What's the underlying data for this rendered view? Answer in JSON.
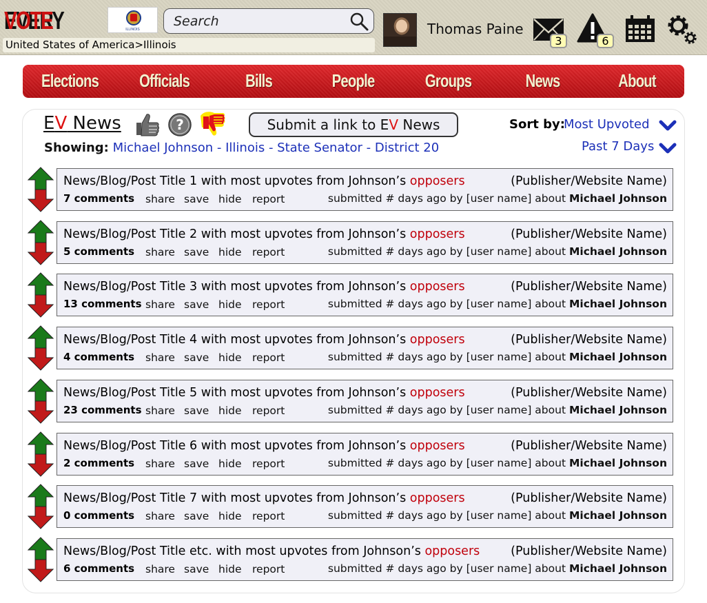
{
  "header": {
    "logo_every": "EVERY",
    "logo_vote": "VOTE",
    "flag_caption": "ILLINOIS",
    "search_placeholder": "Search",
    "breadcrumb": "United States of America>Illinois",
    "username": "Thomas Paine",
    "mail_count": "3",
    "alert_count": "6"
  },
  "nav": [
    "Elections",
    "Officials",
    "Bills",
    "People",
    "Groups",
    "News",
    "About"
  ],
  "news": {
    "title_e": "E",
    "title_v": "V",
    "title_rest": " News",
    "submit_prefix": "Submit a link to E",
    "submit_v": "V",
    "submit_suffix": " News",
    "sort_label": "Sort by:",
    "sort_value": "Most Upvoted",
    "range_value": "Past 7 Days",
    "showing_label": "Showing:",
    "showing_value": "Michael Johnson - Illinois - State Senator - District 20"
  },
  "colors": {
    "accent_red": "#c0000b",
    "link_blue": "#1c30b8",
    "nav_red": "#d01a1e",
    "upvote_green": "#1a7a1a",
    "downvote_red": "#c11a1a"
  },
  "actions": {
    "share": "share",
    "save": "save",
    "hide": "hide",
    "report": "report"
  },
  "posts": [
    {
      "title": "News/Blog/Post Title 1 with most upvotes from Johnson’s ",
      "highlight": "opposers",
      "publisher": "(Publisher/Website Name)",
      "comments": "7 comments",
      "meta_prefix": "submitted # days ago by [user name] about ",
      "meta_subject": "Michael Johnson"
    },
    {
      "title": "News/Blog/Post Title 2 with most upvotes from Johnson’s ",
      "highlight": "opposers",
      "publisher": "(Publisher/Website Name)",
      "comments": "5 comments",
      "meta_prefix": "submitted # days ago by [user name] about ",
      "meta_subject": "Michael Johnson"
    },
    {
      "title": "News/Blog/Post Title 3 with most upvotes from Johnson’s ",
      "highlight": "opposers",
      "publisher": "(Publisher/Website Name)",
      "comments": "13 comments",
      "meta_prefix": "submitted # days ago by [user name] about ",
      "meta_subject": "Michael Johnson"
    },
    {
      "title": "News/Blog/Post Title 4 with most upvotes from Johnson’s ",
      "highlight": "opposers",
      "publisher": "(Publisher/Website Name)",
      "comments": "4 comments",
      "meta_prefix": "submitted # days ago by [user name] about ",
      "meta_subject": "Michael Johnson"
    },
    {
      "title": "News/Blog/Post Title 5 with most upvotes from Johnson’s ",
      "highlight": "opposers",
      "publisher": "(Publisher/Website Name)",
      "comments": "23 comments",
      "meta_prefix": "submitted # days ago by [user name] about ",
      "meta_subject": "Michael Johnson"
    },
    {
      "title": "News/Blog/Post Title 6 with most upvotes from Johnson’s ",
      "highlight": "opposers",
      "publisher": "(Publisher/Website Name)",
      "comments": "2 comments",
      "meta_prefix": "submitted # days ago by [user name] about ",
      "meta_subject": "Michael Johnson"
    },
    {
      "title": "News/Blog/Post Title 7 with most upvotes from Johnson’s ",
      "highlight": "opposers",
      "publisher": "(Publisher/Website Name)",
      "comments": "0 comments",
      "meta_prefix": "submitted # days ago by [user name] about ",
      "meta_subject": "Michael Johnson"
    },
    {
      "title": "News/Blog/Post Title etc. with most upvotes from Johnson’s ",
      "highlight": "opposers",
      "publisher": "(Publisher/Website Name)",
      "comments": "6 comments",
      "meta_prefix": "submitted # days ago by [user name] about ",
      "meta_subject": "Michael Johnson"
    }
  ]
}
